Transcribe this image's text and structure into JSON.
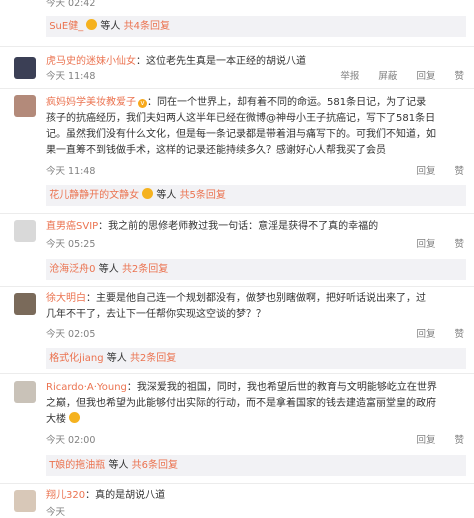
{
  "top": {
    "time": "今天 02:42"
  },
  "replies": [
    {
      "name": "SuE健_",
      "text": "等人",
      "link": "共4条回复"
    },
    {
      "name": "花儿静静开的文静女",
      "text": "等人",
      "link": "共5条回复"
    },
    {
      "name": "沧海泛舟0",
      "text": "等人",
      "link": "共2条回复"
    },
    {
      "name": "格式化jiang",
      "text": "等人",
      "link": "共2条回复"
    },
    {
      "name": "T娘的拖油瓶",
      "text": "等人",
      "link": "共6条回复"
    }
  ],
  "comments": [
    {
      "name": "虎马史的迷妹小仙女",
      "text": "这位老先生真是一本正经的胡说八道",
      "time": "今天 11:48",
      "actions": [
        "举报",
        "屏蔽",
        "回复",
        "赞"
      ]
    },
    {
      "name": "疯妈妈学美妆教爱子",
      "lines": [
        "同在一个世界上，却有着不同的命运。581条日记，为了记录",
        "孩子的抗癌经历，我们夫妇两人这半年已经在微博@神母小王子抗癌记，写下了581条日",
        "记。虽然我们没有什么文化，但是每一条记录都是带着泪与痛写下的。可我们不知道，如",
        "果一直筹不到钱做手术，这样的记录还能持续多久？感谢好心人帮我买了会员"
      ],
      "time": "今天 11:48",
      "actions": [
        "回复",
        "赞"
      ]
    },
    {
      "name": "直男癌SVIP",
      "text": "我之前的思修老师教过我一句话：意淫是获得不了真的幸福的",
      "time": "今天 05:25",
      "actions": [
        "回复",
        "赞"
      ]
    },
    {
      "name": "徐大明白",
      "lines": [
        "主要是他自己连一个规划都没有，做梦也别瞎做啊，把好听话说出来了，过",
        "几年不干了，去让下一任帮你实现这空谈的梦？？"
      ],
      "time": "今天 02:05",
      "actions": [
        "回复",
        "赞"
      ]
    },
    {
      "name": "Ricardo·A·Young",
      "lines": [
        "我深爱我的祖国，同时，我也希望后世的教育与文明能够屹立在世界",
        "之巅，但我也希望为此能够付出实际的行动，而不是拿着国家的钱去建造富丽堂皇的政府",
        "大楼"
      ],
      "time": "今天 02:00",
      "actions": [
        "回复",
        "赞"
      ]
    },
    {
      "name": "翔儿320",
      "text": "真的是胡说八道",
      "time": "今天"
    }
  ]
}
